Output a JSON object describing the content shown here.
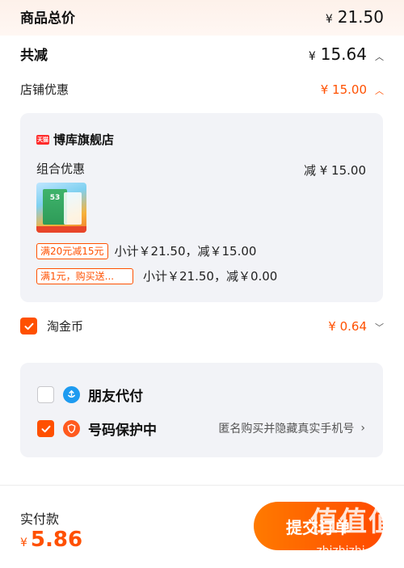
{
  "summary": {
    "goods_total_label": "商品总价",
    "goods_total_currency": "¥",
    "goods_total_value": "21.50",
    "reduction_label": "共减",
    "reduction_currency": "¥",
    "reduction_value": "15.64"
  },
  "store_discount": {
    "label": "店铺优惠",
    "amount": "¥ 15.00"
  },
  "store_card": {
    "logo_text": "天猫",
    "store_name": "博库旗舰店",
    "combo_label": "组合优惠",
    "combo_reduce": "减 ¥ 15.00",
    "product_cover_text": "53",
    "promo_rows": [
      {
        "tag": "满20元减15元",
        "text": "小计￥21.50，减￥15.00"
      },
      {
        "tag": "满1元，购买送...",
        "text": "小计￥21.50，减￥0.00"
      }
    ]
  },
  "taojinbi": {
    "label": "淘金币",
    "amount": "¥ 0.64",
    "checked": true
  },
  "services": {
    "friend_pay_label": "朋友代付",
    "friend_pay_checked": false,
    "number_protect_label": "号码保护中",
    "number_protect_checked": true,
    "number_protect_hint": "匿名购买并隐藏真实手机号"
  },
  "footer": {
    "pay_label": "实付款",
    "pay_currency": "¥",
    "pay_amount": "5.86",
    "submit_label": "提交订单"
  },
  "watermark": {
    "text": "值值值",
    "url": "zhizhizhi.com"
  },
  "colors": {
    "accent": "#ff5000",
    "card_bg": "#f2f3f7",
    "page_bg": "#f0f1f5"
  },
  "icons": [
    "chevron-up-icon",
    "chevron-down-icon",
    "checkbox-checked-icon",
    "checkbox-empty-icon",
    "friend-pay-icon",
    "shield-icon",
    "chevron-right-icon"
  ]
}
